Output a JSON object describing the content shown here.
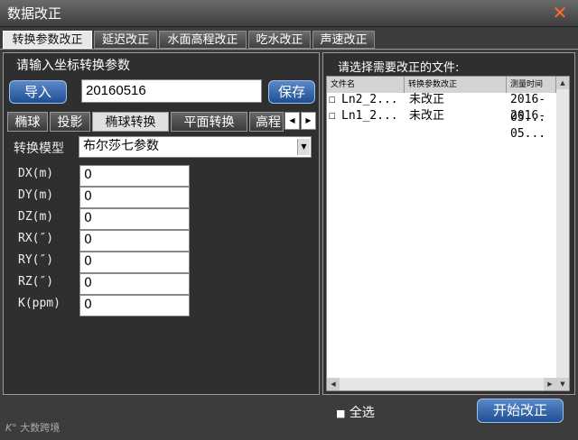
{
  "window": {
    "title": "数据改正",
    "close_glyph": "✕"
  },
  "main_tabs": [
    {
      "label": "转换参数改正",
      "active": true
    },
    {
      "label": "延迟改正"
    },
    {
      "label": "水面高程改正"
    },
    {
      "label": "吃水改正"
    },
    {
      "label": "声速改正"
    }
  ],
  "left_panel": {
    "heading": "请输入坐标转换参数",
    "import_label": "导入",
    "date_value": "20160516",
    "save_label": "保存",
    "sub_tabs": [
      "椭球",
      "投影",
      "椭球转换",
      "平面转换",
      "高程"
    ],
    "active_sub_tab": 2,
    "model_label": "转换模型",
    "model_value": "布尔莎七参数",
    "params": [
      {
        "label": "DX(m)",
        "value": "0"
      },
      {
        "label": "DY(m)",
        "value": "0"
      },
      {
        "label": "DZ(m)",
        "value": "0"
      },
      {
        "label": "RX(″)",
        "value": "0"
      },
      {
        "label": "RY(″)",
        "value": "0"
      },
      {
        "label": "RZ(″)",
        "value": "0"
      },
      {
        "label": "K(ppm)",
        "value": "0"
      }
    ]
  },
  "right_panel": {
    "heading": "请选择需要改正的文件:",
    "columns": [
      "文件名",
      "转换参数改正",
      "测量时间"
    ],
    "rows": [
      {
        "file": "Ln2_2...",
        "status": "未改正",
        "time": "2016-05..."
      },
      {
        "file": "Ln1_2...",
        "status": "未改正",
        "time": "2016-05..."
      }
    ],
    "select_all_label": "全选",
    "start_label": "开始改正"
  },
  "watermark": {
    "text": "大数跨境"
  }
}
